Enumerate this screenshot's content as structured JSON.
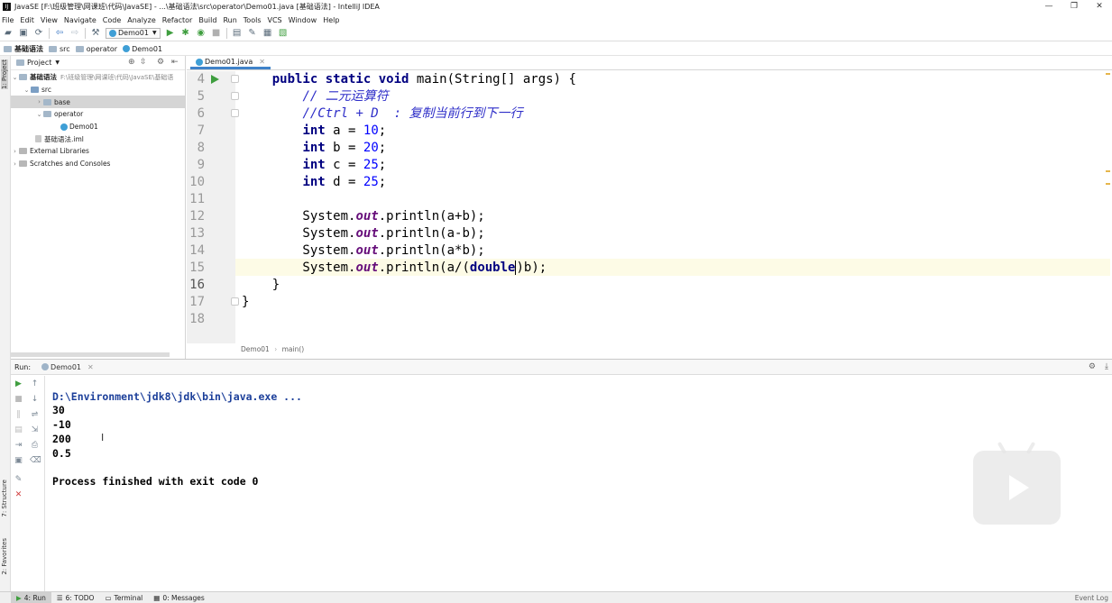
{
  "window": {
    "title": "JavaSE [F:\\班级管理\\网课班\\代码\\JavaSE] - ...\\基础语法\\src\\operator\\Demo01.java [基础语法] - IntelliJ IDEA",
    "controls": [
      "—",
      "❐",
      "✕"
    ]
  },
  "menu": [
    "File",
    "Edit",
    "View",
    "Navigate",
    "Code",
    "Analyze",
    "Refactor",
    "Build",
    "Run",
    "Tools",
    "VCS",
    "Window",
    "Help"
  ],
  "toolbar": {
    "run_config": "Demo01"
  },
  "breadcrumb": [
    "基础语法",
    "src",
    "operator",
    "Demo01"
  ],
  "side_tabs": {
    "project": "1: Project",
    "structure": "7: Structure",
    "favorites": "2: Favorites"
  },
  "project_panel": {
    "header": "Project",
    "tree": [
      {
        "label": "基础语法",
        "hint": "F:\\班级管理\\网课班\\代码\\JavaSE\\基础语",
        "level": 0,
        "expanded": true
      },
      {
        "label": "src",
        "level": 1,
        "expanded": true
      },
      {
        "label": "base",
        "level": 2,
        "expanded": false,
        "selected": true
      },
      {
        "label": "operator",
        "level": 2,
        "expanded": true
      },
      {
        "label": "Demo01",
        "level": 3
      },
      {
        "label": "基础语法.iml",
        "level": 1
      },
      {
        "label": "External Libraries",
        "level": 0,
        "expanded": false
      },
      {
        "label": "Scratches and Consoles",
        "level": 0,
        "expanded": false
      }
    ]
  },
  "editor": {
    "tab": "Demo01.java",
    "line_numbers": [
      "4",
      "5",
      "6",
      "7",
      "8",
      "9",
      "10",
      "11",
      "12",
      "13",
      "14",
      "15",
      "16",
      "17",
      "18"
    ],
    "current_line": "15",
    "breadcrumb": [
      "Demo01",
      "main()"
    ]
  },
  "run_panel": {
    "label": "Run:",
    "tab": "Demo01",
    "command": "D:\\Environment\\jdk8\\jdk\\bin\\java.exe ...",
    "output": [
      "30",
      "-10",
      "200",
      "0.5"
    ],
    "exit": "Process finished with exit code 0"
  },
  "status_tabs": [
    "4: Run",
    "6: TODO",
    "Terminal",
    "0: Messages"
  ],
  "status_right": "Event Log"
}
